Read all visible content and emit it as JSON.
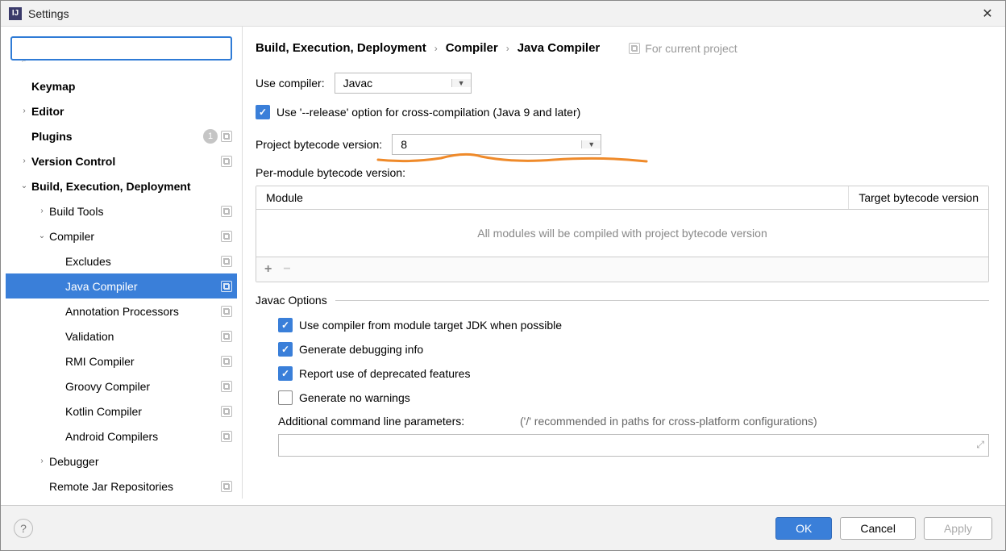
{
  "window": {
    "title": "Settings"
  },
  "sidebar": {
    "search_placeholder": "",
    "items": [
      {
        "label": "Keymap",
        "level": 0,
        "bold": true,
        "chev": ""
      },
      {
        "label": "Editor",
        "level": 0,
        "bold": true,
        "chev": "›"
      },
      {
        "label": "Plugins",
        "level": 0,
        "bold": true,
        "chev": "",
        "badge_count": "1",
        "proj": true
      },
      {
        "label": "Version Control",
        "level": 0,
        "bold": true,
        "chev": "›",
        "proj": true
      },
      {
        "label": "Build, Execution, Deployment",
        "level": 0,
        "bold": true,
        "chev": "⌄"
      },
      {
        "label": "Build Tools",
        "level": 1,
        "chev": "›",
        "proj": true
      },
      {
        "label": "Compiler",
        "level": 1,
        "chev": "⌄",
        "proj": true
      },
      {
        "label": "Excludes",
        "level": 2,
        "proj": true
      },
      {
        "label": "Java Compiler",
        "level": 2,
        "selected": true,
        "proj": true
      },
      {
        "label": "Annotation Processors",
        "level": 2,
        "proj": true
      },
      {
        "label": "Validation",
        "level": 2,
        "proj": true
      },
      {
        "label": "RMI Compiler",
        "level": 2,
        "proj": true
      },
      {
        "label": "Groovy Compiler",
        "level": 2,
        "proj": true
      },
      {
        "label": "Kotlin Compiler",
        "level": 2,
        "proj": true
      },
      {
        "label": "Android Compilers",
        "level": 2,
        "proj": true
      },
      {
        "label": "Debugger",
        "level": 1,
        "chev": "›"
      },
      {
        "label": "Remote Jar Repositories",
        "level": 1,
        "proj": true
      }
    ]
  },
  "breadcrumb": {
    "seg1": "Build, Execution, Deployment",
    "seg2": "Compiler",
    "seg3": "Java Compiler",
    "for_project": "For current project"
  },
  "form": {
    "use_compiler_label": "Use compiler:",
    "use_compiler_value": "Javac",
    "release_option_checked": true,
    "release_option_label": "Use '--release' option for cross-compilation (Java 9 and later)",
    "bytecode_label": "Project bytecode version:",
    "bytecode_value": "8",
    "per_module_label": "Per-module bytecode version:",
    "table": {
      "col1": "Module",
      "col2": "Target bytecode version",
      "empty_text": "All modules will be compiled with project bytecode version"
    },
    "javac_options_title": "Javac Options",
    "opts": [
      {
        "checked": true,
        "label": "Use compiler from module target JDK when possible"
      },
      {
        "checked": true,
        "label": "Generate debugging info"
      },
      {
        "checked": true,
        "label": "Report use of deprecated features"
      },
      {
        "checked": false,
        "label": "Generate no warnings"
      }
    ],
    "params_label": "Additional command line parameters:",
    "params_hint": "('/' recommended in paths for cross-platform configurations)"
  },
  "footer": {
    "ok": "OK",
    "cancel": "Cancel",
    "apply": "Apply"
  }
}
